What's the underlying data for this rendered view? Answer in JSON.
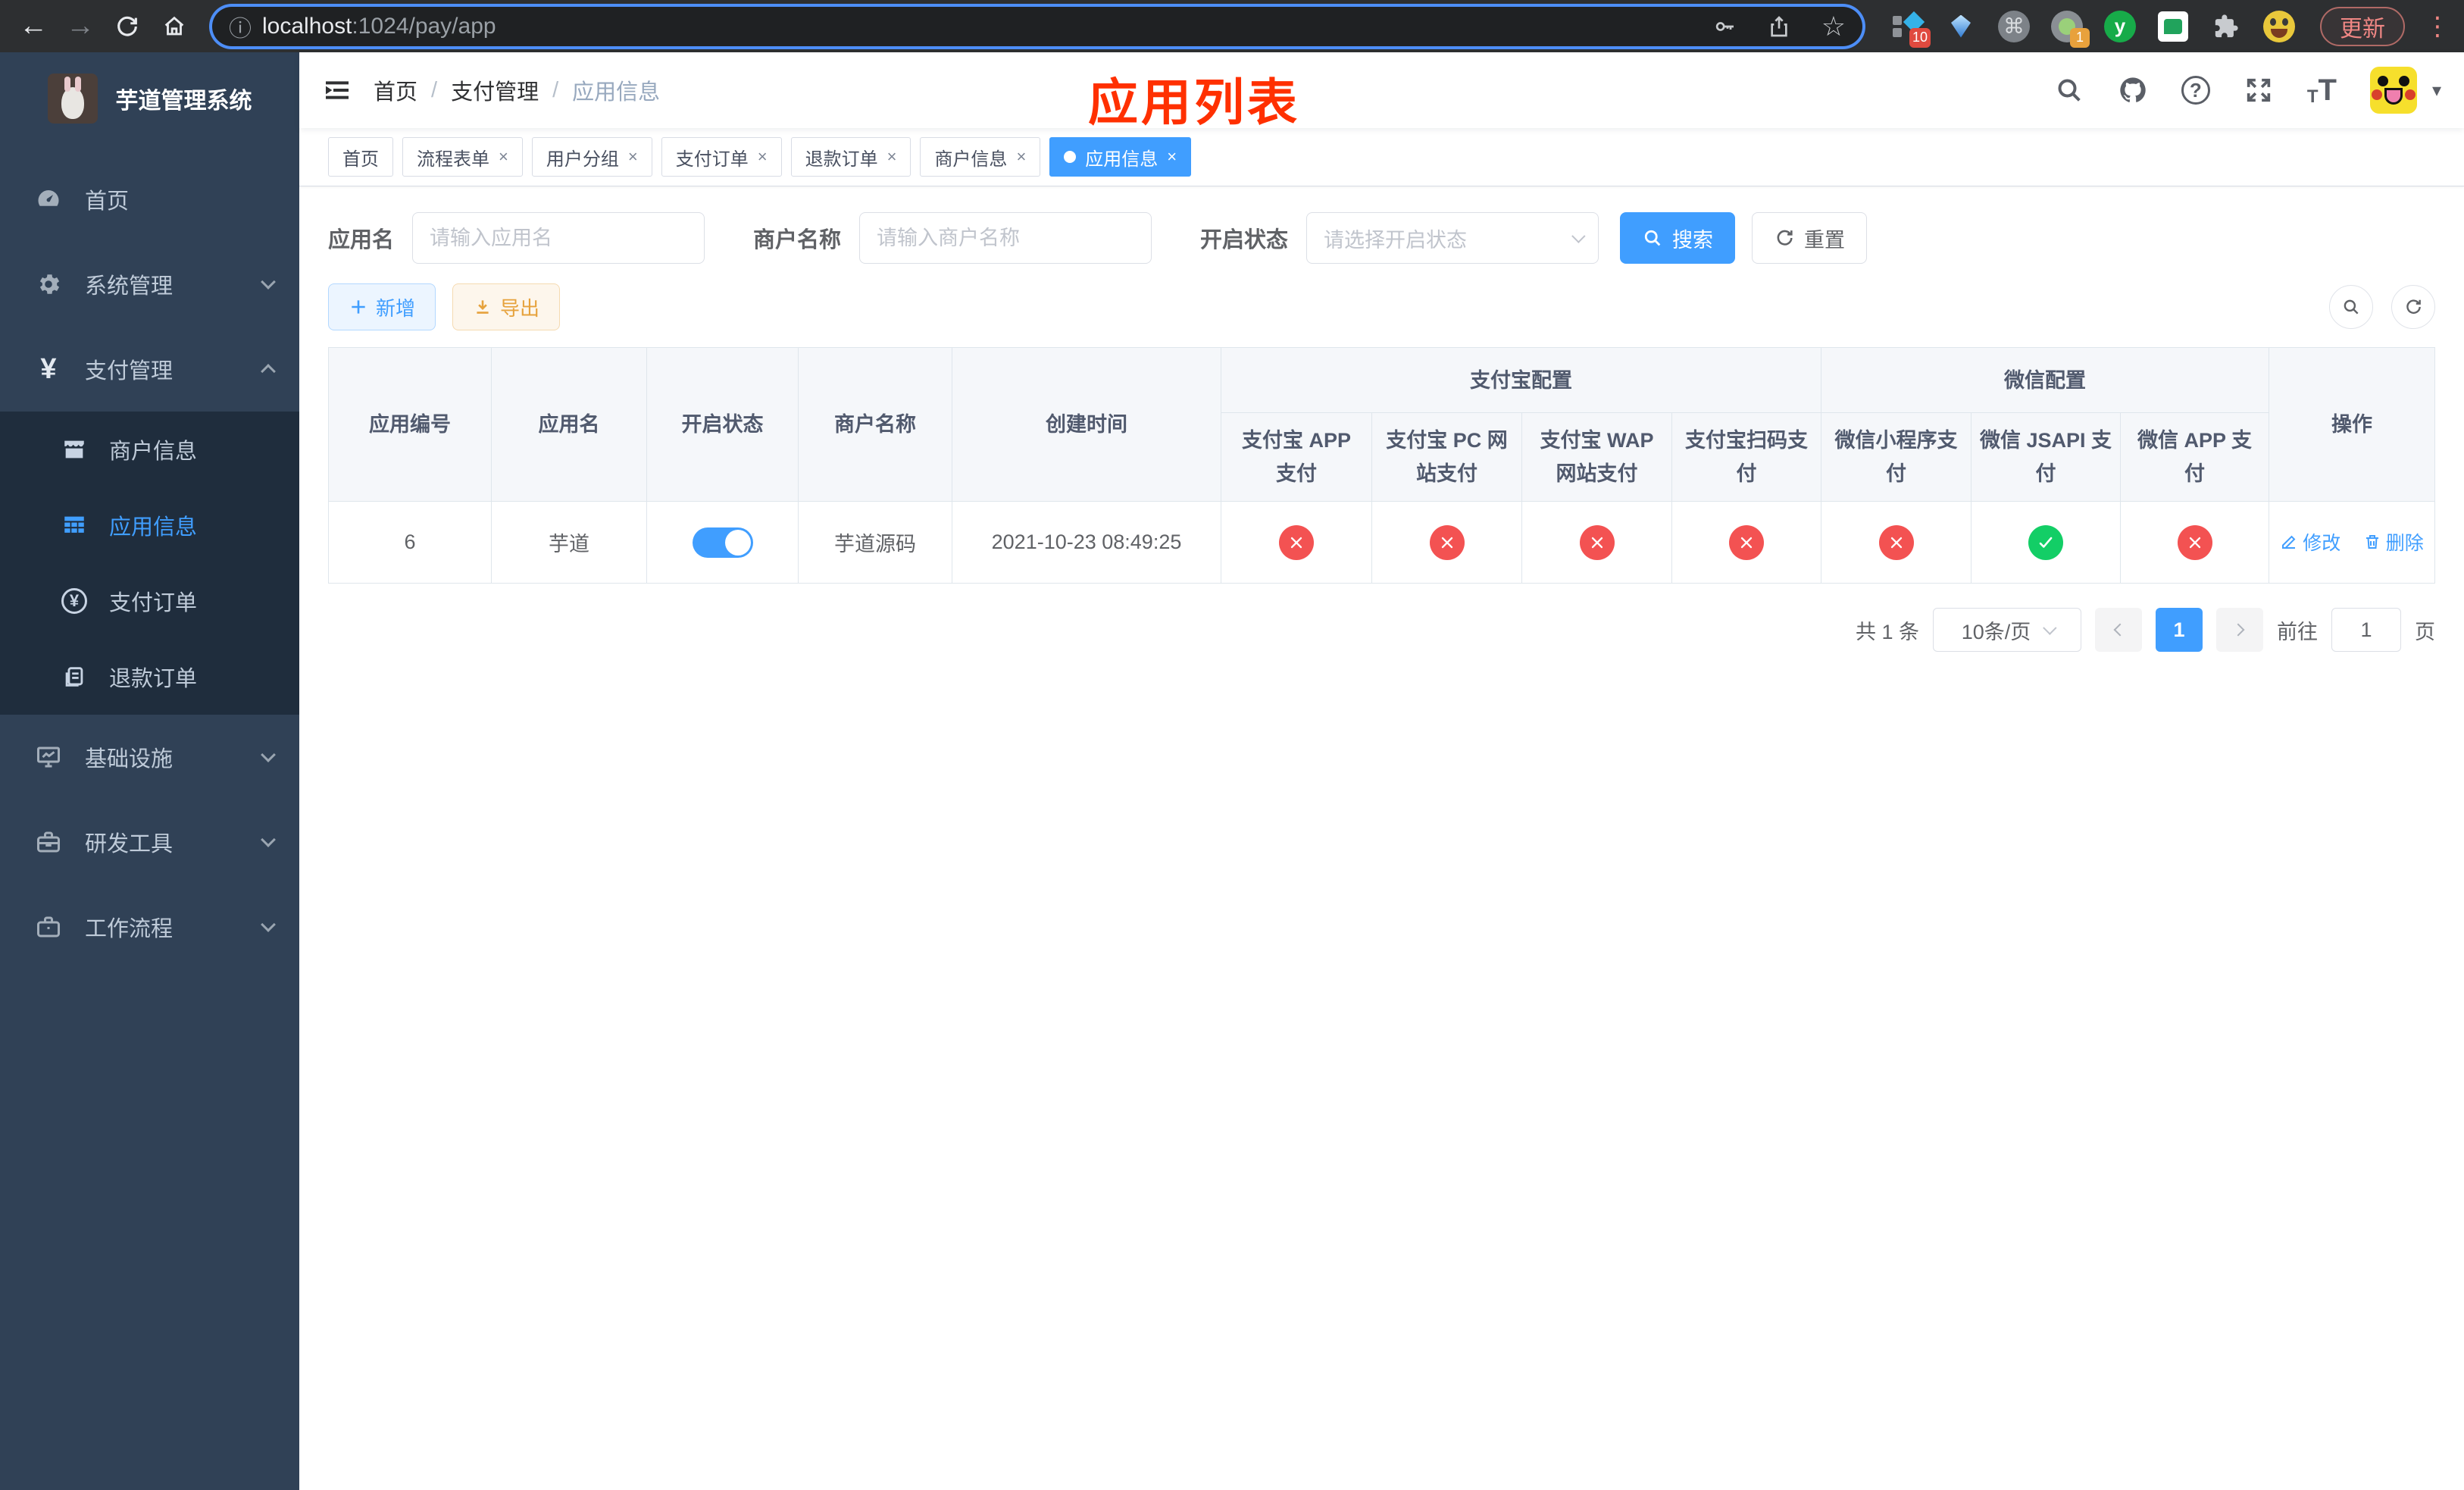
{
  "browser": {
    "url": {
      "host": "localhost",
      "path": ":1024/pay/app"
    },
    "update_label": "更新",
    "ext_badges": {
      "first": "10",
      "fourth": "1"
    },
    "ext_letter": "y"
  },
  "icons": {
    "back": "←",
    "forward": "→",
    "star": "☆",
    "info": "ⓘ",
    "command": "⌘",
    "dots": "⋮",
    "caret_down": "▾",
    "yen": "¥",
    "plus": "＋",
    "question": "?",
    "font_small": "T",
    "font_big": "T"
  },
  "sidebar": {
    "logo_title": "芋道管理系统",
    "menu": [
      {
        "label": "首页"
      },
      {
        "label": "系统管理"
      },
      {
        "label": "支付管理"
      }
    ],
    "submenu": [
      {
        "label": "商户信息"
      },
      {
        "label": "应用信息"
      },
      {
        "label": "支付订单"
      },
      {
        "label": "退款订单"
      }
    ],
    "menu_lower": [
      {
        "label": "基础设施"
      },
      {
        "label": "研发工具"
      },
      {
        "label": "工作流程"
      }
    ]
  },
  "navbar": {
    "breadcrumb": [
      "首页",
      "支付管理",
      "应用信息"
    ],
    "separator": "/",
    "overlay_title": "应用列表"
  },
  "tabs": [
    {
      "label": "首页"
    },
    {
      "label": "流程表单"
    },
    {
      "label": "用户分组"
    },
    {
      "label": "支付订单"
    },
    {
      "label": "退款订单"
    },
    {
      "label": "商户信息"
    },
    {
      "label": "应用信息"
    }
  ],
  "filters": {
    "app_name_label": "应用名",
    "app_name_placeholder": "请输入应用名",
    "merchant_label": "商户名称",
    "merchant_placeholder": "请输入商户名称",
    "status_label": "开启状态",
    "status_placeholder": "请选择开启状态",
    "search_label": "搜索",
    "reset_label": "重置"
  },
  "toolbar": {
    "add_label": "新增",
    "export_label": "导出"
  },
  "table": {
    "columns": [
      "应用编号",
      "应用名",
      "开启状态",
      "商户名称",
      "创建时间"
    ],
    "groups": [
      {
        "label": "支付宝配置",
        "children": [
          "支付宝 APP 支付",
          "支付宝 PC 网站支付",
          "支付宝 WAP 网站支付",
          "支付宝扫码支付"
        ]
      },
      {
        "label": "微信配置",
        "children": [
          "微信小程序支付",
          "微信 JSAPI 支付",
          "微信 APP 支付"
        ]
      }
    ],
    "action_column": "操作",
    "row": {
      "id": "6",
      "name": "芋道",
      "enabled": true,
      "merchant": "芋道源码",
      "created": "2021-10-23 08:49:25",
      "statuses": [
        "cross",
        "cross",
        "cross",
        "cross",
        "cross",
        "check",
        "cross"
      ],
      "edit_label": "修改",
      "delete_label": "删除"
    }
  },
  "pagination": {
    "total": "共 1 条",
    "page_size": "10条/页",
    "current": "1",
    "goto_prefix": "前往",
    "goto_value": "1",
    "goto_suffix": "页"
  },
  "colors": {
    "accent": "#409eff",
    "danger": "#f35252",
    "success": "#13ce66",
    "warning": "#e6a23c",
    "title_red": "#ff3000",
    "sidebar_bg": "#304156",
    "submenu_bg": "#1f2d3d"
  }
}
